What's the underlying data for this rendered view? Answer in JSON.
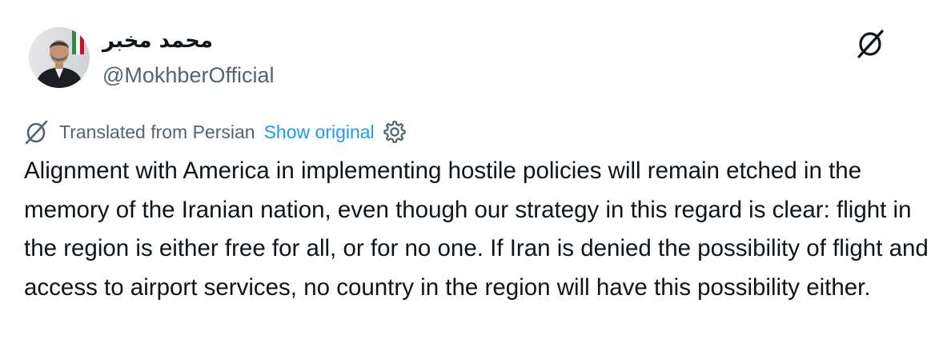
{
  "author": {
    "display_name": "محمد مخبر",
    "handle": "@MokhberOfficial"
  },
  "icons": {
    "top_right": "translate-icon",
    "translation": "translate-icon",
    "settings": "gear-icon"
  },
  "translation": {
    "label": "Translated from Persian",
    "show_original": "Show original"
  },
  "tweet": {
    "text": "Alignment with America in implementing hostile policies will remain etched in the memory of the Iranian nation, even though our strategy in this regard is clear: flight in the region is either free for all, or for no one. If Iran is denied the possibility of flight and access to airport services, no country in the region will have this possibility either."
  },
  "colors": {
    "text": "#0f1419",
    "secondary": "#536471",
    "link": "#1d9bf0"
  }
}
